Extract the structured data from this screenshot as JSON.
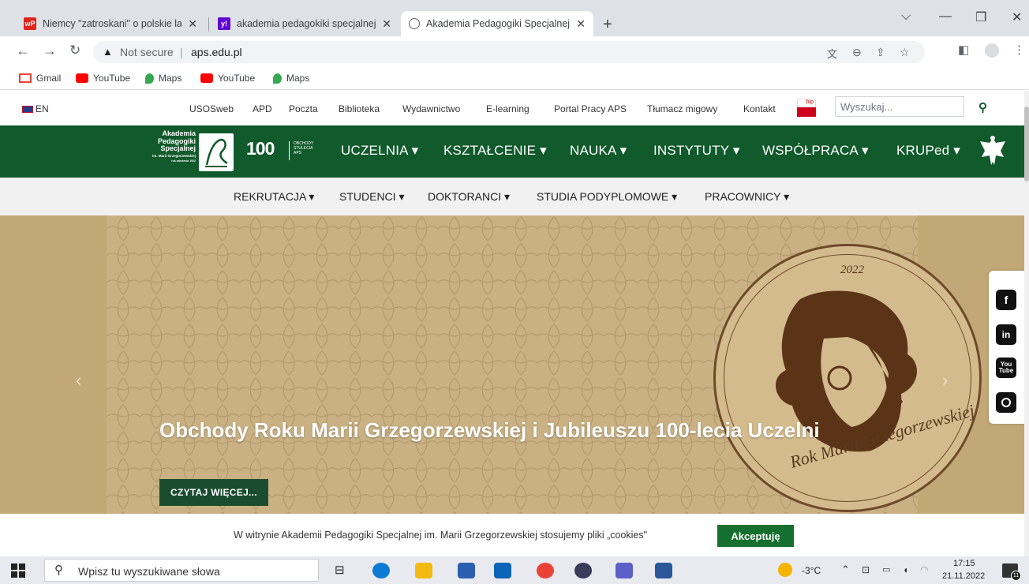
{
  "browser": {
    "tabs": [
      {
        "title": "Niemcy \"zatroskani\" o polskie las",
        "favicon": "wp-icon",
        "active": false
      },
      {
        "title": "akademia pedagokiki specjalnej",
        "favicon": "yahoo-icon",
        "active": false
      },
      {
        "title": "Akademia Pedagogiki Specjalnej",
        "favicon": "globe-icon",
        "active": true
      }
    ],
    "new_tab": "+",
    "security_label": "Not secure",
    "url": "aps.edu.pl",
    "bookmarks": [
      {
        "label": "Gmail",
        "icon": "gmail-icon"
      },
      {
        "label": "YouTube",
        "icon": "youtube-icon"
      },
      {
        "label": "Maps",
        "icon": "maps-icon"
      },
      {
        "label": "YouTube",
        "icon": "youtube-icon"
      },
      {
        "label": "Maps",
        "icon": "maps-icon"
      }
    ]
  },
  "site": {
    "lang": "EN",
    "top_links": [
      "USOSweb",
      "APD",
      "Poczta",
      "Biblioteka",
      "Wydawnictwo",
      "E-learning",
      "Portal Pracy APS",
      "Tłumacz migowy",
      "Kontakt"
    ],
    "bip_label": "bip",
    "search_placeholder": "Wyszukaj...",
    "logo": {
      "line1": "Akademia",
      "line2": "Pedagogiki",
      "line3": "Specjalnej",
      "line4": "im. Marii Grzegorzewskiej",
      "line5": "rok założenia 1922",
      "anniv_num": "100",
      "anniv_text1": "OBCHODY",
      "anniv_text2": "STULECIA",
      "anniv_text3": "APS"
    },
    "main_nav": [
      "UCZELNIA",
      "KSZTAŁCENIE",
      "NAUKA",
      "INSTYTUTY",
      "WSPÓŁPRACA",
      "KRUPed"
    ],
    "sub_nav": [
      "REKRUTACJA",
      "STUDENCI",
      "DOKTORANCI",
      "STUDIA PODYPLOMOWE",
      "PRACOWNICY"
    ],
    "hero": {
      "title": "Obchody Roku Marii Grzegorzewskiej i Jubileuszu 100-lecia Uczelni",
      "button": "CZYTAJ WIĘCEJ...",
      "medal_year": "2022",
      "medal_script": "Rok Marii Grzegorzewskiej"
    },
    "social": [
      "facebook-icon",
      "linkedin-icon",
      "youtube-icon",
      "instagram-icon"
    ],
    "cookie": {
      "text": "W witrynie Akademii Pedagogiki Specjalnej im. Marii Grzegorzewskiej stosujemy pliki „cookies\"",
      "button": "Akceptuję"
    },
    "colors": {
      "green": "#115a2c",
      "button_green": "#156f2f",
      "hero_gold": "#c9b184"
    }
  },
  "taskbar": {
    "search_placeholder": "Wpisz tu wyszukiwane słowa",
    "weather": "-3°C",
    "time": "17:15",
    "date": "21.11.2022",
    "notif_count": "11"
  }
}
